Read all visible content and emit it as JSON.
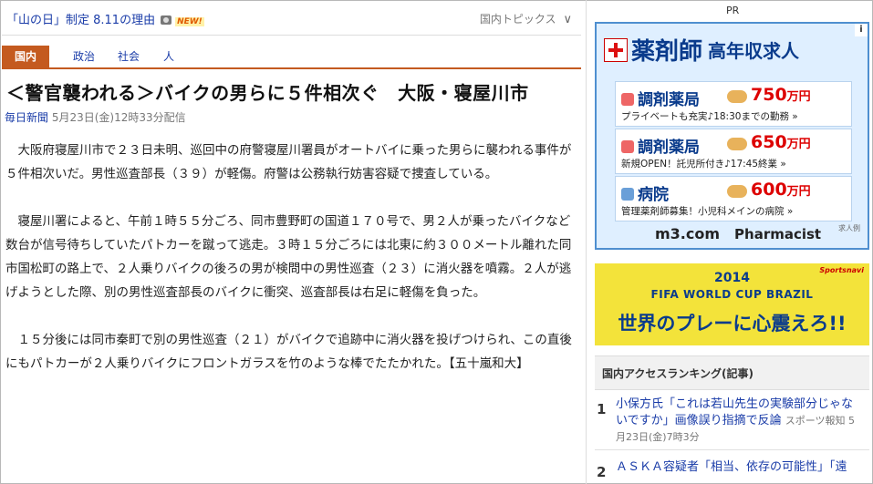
{
  "topbar": {
    "headline_link": "「山の日」制定 8.11の理由",
    "new_badge": "NEW!",
    "topics_label": "国内トピックス",
    "topics_chevron": "∨"
  },
  "category_tabs": [
    "国内",
    "政治",
    "社会",
    "人"
  ],
  "article": {
    "title": "＜警官襲われる＞バイクの男らに５件相次ぐ　大阪・寝屋川市",
    "source": "毎日新聞",
    "date": "5月23日(金)12時33分配信",
    "paragraphs": [
      "大阪府寝屋川市で２３日未明、巡回中の府警寝屋川署員がオートバイに乗った男らに襲われる事件が５件相次いだ。男性巡査部長（３９）が軽傷。府警は公務執行妨害容疑で捜査している。",
      "寝屋川署によると、午前１時５５分ごろ、同市豊野町の国道１７０号で、男２人が乗ったバイクなど数台が信号待ちしていたパトカーを蹴って逃走。３時１５分ごろには北東に約３００メートル離れた同市国松町の路上で、２人乗りバイクの後ろの男が検問中の男性巡査（２３）に消火器を噴霧。２人が逃げようとした際、別の男性巡査部長のバイクに衝突、巡査部長は右足に軽傷を負った。",
      "１５分後には同市秦町で別の男性巡査（２１）がバイクで追跡中に消火器を投げつけられ、この直後にもパトカーが２人乗りバイクにフロントガラスを竹のような棒でたたかれた。【五十嵐和大】"
    ]
  },
  "sidebar": {
    "pr_label": "PR",
    "ad_pharmacy": {
      "info_icon": "i",
      "title_main": "薬剤師",
      "title_sub": "高年収求人",
      "jobs": [
        {
          "type": "調剤薬局",
          "salary": "750",
          "unit": "万円",
          "desc": "プライベートも充実♪18:30までの勤務 »"
        },
        {
          "type": "調剤薬局",
          "salary": "650",
          "unit": "万円",
          "desc": "新規OPEN！託児所付き♪17:45終業 »"
        },
        {
          "type": "病院",
          "salary": "600",
          "unit": "万円",
          "desc": "管理薬剤師募集！小児科メインの病院 »"
        }
      ],
      "logo": "m3.com",
      "logo_sub": "Pharmacist",
      "note": "求人例"
    },
    "ad_worldcup": {
      "brand": "Sportsnavi",
      "year": "2014",
      "event": "FIFA WORLD CUP BRAZIL",
      "tagline": "世界のプレーに心震えろ!!"
    },
    "ranking": {
      "title": "国内アクセスランキング(記事)",
      "items": [
        {
          "rank": "1",
          "text": "小保方氏「これは若山先生の実験部分じゃないですか」画像誤り指摘で反論",
          "meta": "スポーツ報知 5月23日(金)7時3分"
        },
        {
          "rank": "2",
          "text": "ＡＳＫＡ容疑者「相当、依存の可能性」「遠",
          "meta": ""
        }
      ]
    }
  }
}
